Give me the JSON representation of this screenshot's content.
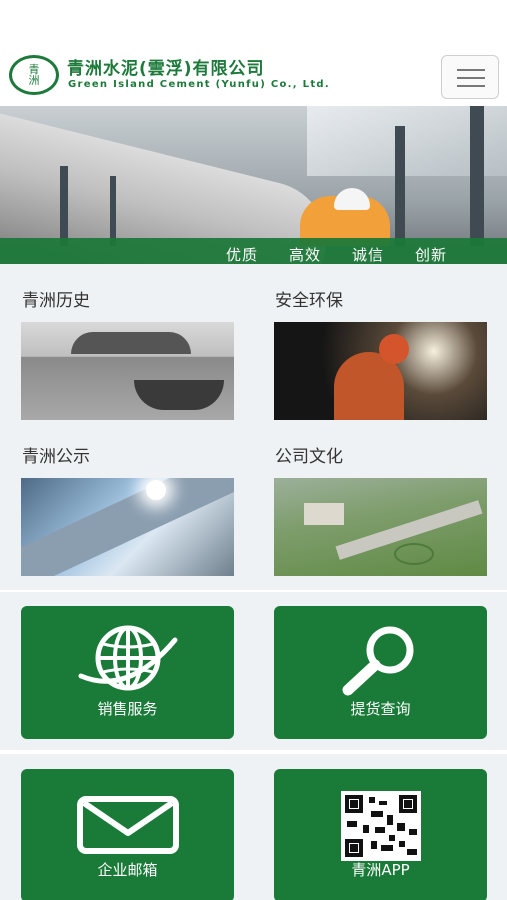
{
  "header": {
    "logo_mark": "青洲",
    "company_name_cn": "青洲水泥(雲浮)有限公司",
    "company_name_en": "Green Island Cement (Yunfu) Co., Ltd.",
    "menu_icon": "hamburger-menu-icon"
  },
  "hero": {
    "tags": [
      "优质",
      "高效",
      "诚信",
      "创新"
    ]
  },
  "sections": [
    {
      "title": "青洲历史"
    },
    {
      "title": "安全环保"
    },
    {
      "title": "青洲公示"
    },
    {
      "title": "公司文化"
    }
  ],
  "services": [
    {
      "label": "销售服务",
      "icon": "globe-icon"
    },
    {
      "label": "提货查询",
      "icon": "magnifier-icon"
    },
    {
      "label": "企业邮箱",
      "icon": "envelope-icon"
    },
    {
      "label": "青洲APP",
      "icon": "qr-code-icon"
    }
  ],
  "colors": {
    "brand_green": "#1a7b39",
    "page_background": "#eef2f4"
  }
}
